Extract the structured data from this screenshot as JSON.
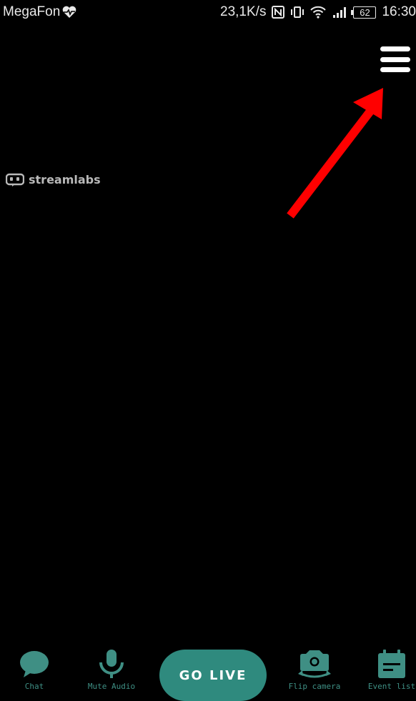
{
  "status_bar": {
    "carrier": "MegaFon",
    "net_speed": "23,1K/s",
    "battery": "62",
    "time": "16:30"
  },
  "brand": {
    "name": "streamlabs"
  },
  "menu": {
    "icon": "hamburger-menu-icon"
  },
  "toolbar": {
    "chat_label": "Chat",
    "mute_label": "Mute Audio",
    "go_live_label": "GO LIVE",
    "flip_label": "Flip camera",
    "events_label": "Event list"
  },
  "colors": {
    "background": "#000000",
    "accent": "#2f8a7e",
    "icon_teal": "#3f8f84",
    "annotation_red": "#ff0000"
  }
}
